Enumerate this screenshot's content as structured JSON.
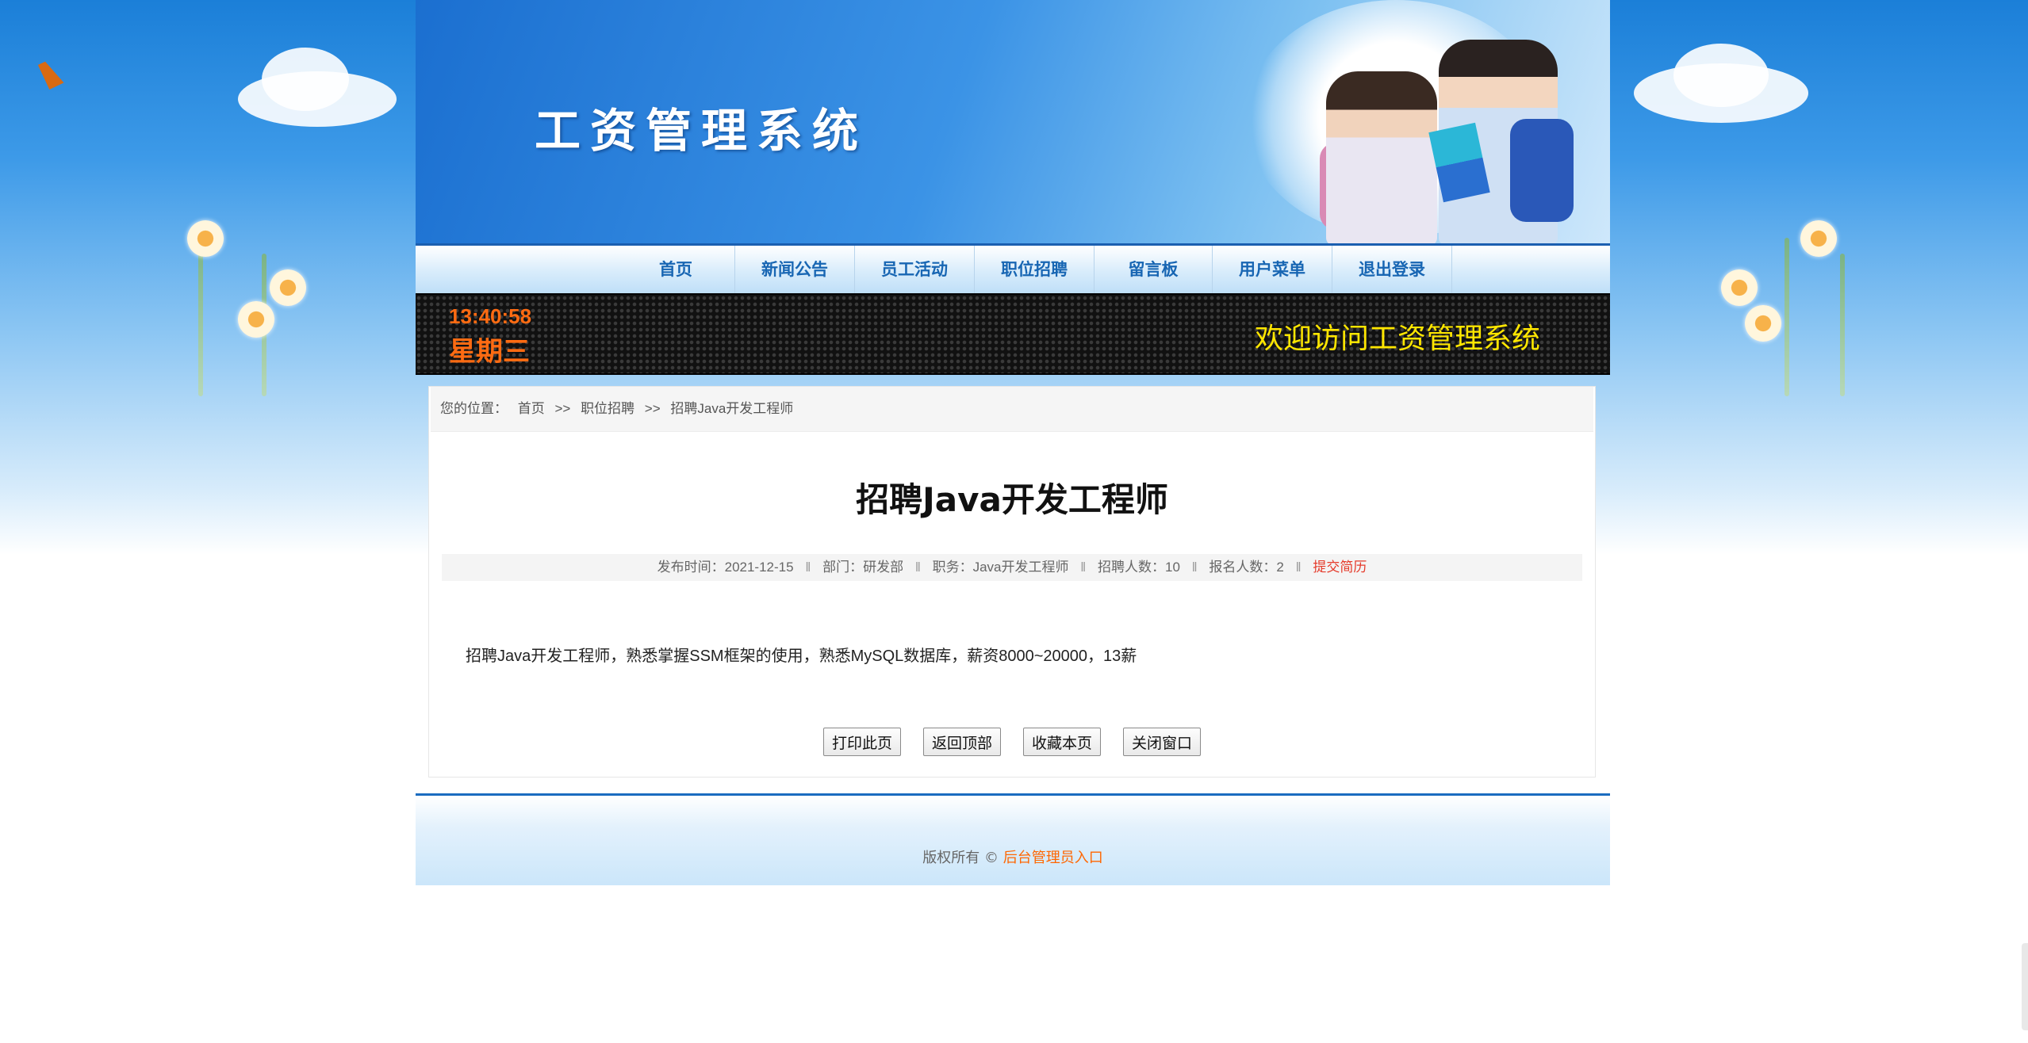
{
  "header": {
    "site_title": "工资管理系统"
  },
  "nav": {
    "items": [
      {
        "label": "首页"
      },
      {
        "label": "新闻公告"
      },
      {
        "label": "员工活动"
      },
      {
        "label": "职位招聘"
      },
      {
        "label": "留言板"
      },
      {
        "label": "用户菜单"
      },
      {
        "label": "退出登录"
      }
    ]
  },
  "clock": {
    "time": "13:40:58",
    "weekday": "星期三",
    "welcome": "欢迎访问工资管理系统"
  },
  "breadcrumb": {
    "prefix": "您的位置：",
    "home": "首页",
    "sep1": ">>",
    "category": "职位招聘",
    "sep2": ">>",
    "current": "招聘Java开发工程师"
  },
  "article": {
    "title": "招聘Java开发工程师",
    "meta": {
      "publish_label": "发布时间：2021-12-15",
      "dept_label": "部门：研发部",
      "position_label": "职务：Java开发工程师",
      "hiring_label": "招聘人数：10",
      "applicants_label": "报名人数：2",
      "separator": "ǁ",
      "submit_label": "提交简历"
    },
    "body": "招聘Java开发工程师，熟悉掌握SSM框架的使用，熟悉MySQL数据库，薪资8000~20000，13薪"
  },
  "buttons": {
    "print": "打印此页",
    "top": "返回顶部",
    "favorite": "收藏本页",
    "close": "关闭窗口"
  },
  "footer": {
    "copyright": "版权所有 © ",
    "admin_link": "后台管理员入口"
  },
  "colors": {
    "nav_text": "#1866b3",
    "clock_text": "#ff6b12",
    "welcome_text": "#ffe600",
    "submit_link": "#e53b2b",
    "admin_link": "#ff6600",
    "footer_border": "#1a6cc0"
  }
}
